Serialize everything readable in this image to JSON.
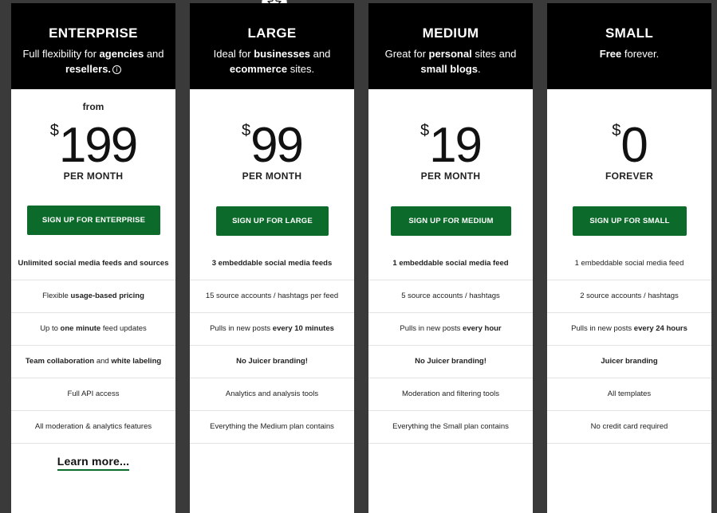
{
  "plans": [
    {
      "name": "ENTERPRISE",
      "desc_pre": "Full flexibility for ",
      "desc_b1": "agencies",
      "desc_mid": " and ",
      "desc_b2": "resellers.",
      "desc_post": "",
      "info_icon": "info-icon",
      "from": "from",
      "dollar": "$",
      "price": "199",
      "period": "PER MONTH",
      "cta": "SIGN UP FOR ENTERPRISE",
      "features": [
        "Unlimited social media feeds and sources",
        [
          "Flexible ",
          "usage-based pricing",
          ""
        ],
        [
          "Up to ",
          "one minute",
          " feed updates"
        ],
        [
          "",
          "Team collaboration",
          " and ",
          "white labeling"
        ],
        "Full API access",
        "All moderation & analytics features"
      ],
      "learn_more": "Learn more..."
    },
    {
      "name": "LARGE",
      "desc_pre": "Ideal for ",
      "desc_b1": "businesses",
      "desc_mid": " and ",
      "desc_b2": "ecommerce",
      "desc_post": " sites.",
      "dollar": "$",
      "price": "99",
      "period": "PER MONTH",
      "cta": "SIGN UP FOR LARGE",
      "features": [
        "3 embeddable social media feeds",
        "15 source accounts / hashtags per feed",
        [
          "Pulls in new posts ",
          "every 10 minutes",
          ""
        ],
        "No Juicer branding!",
        "Analytics and analysis tools",
        "Everything the Medium plan contains"
      ]
    },
    {
      "name": "MEDIUM",
      "desc_pre": "Great for ",
      "desc_b1": "personal",
      "desc_mid": " sites and ",
      "desc_b2": "small blogs",
      "desc_post": ".",
      "dollar": "$",
      "price": "19",
      "period": "PER MONTH",
      "cta": "SIGN UP FOR MEDIUM",
      "features": [
        "1 embeddable social media feed",
        "5 source accounts / hashtags",
        [
          "Pulls in new posts ",
          "every hour",
          ""
        ],
        "No Juicer branding!",
        "Moderation and filtering tools",
        "Everything the Small plan contains"
      ]
    },
    {
      "name": "SMALL",
      "desc_b1": "Free",
      "desc_post": " forever.",
      "dollar": "$",
      "price": "0",
      "period": "FOREVER",
      "cta": "SIGN UP FOR SMALL",
      "features": [
        "1 embeddable social media feed",
        "2 source accounts / hashtags",
        [
          "Pulls in new posts ",
          "every 24 hours",
          ""
        ],
        "Juicer branding",
        "All templates",
        "No credit card required"
      ]
    }
  ],
  "popular_badge_icon": "star-icon",
  "colors": {
    "header_bg": "#000000",
    "cta_green": "#0c6b2a",
    "page_bg": "#3a3a3a"
  }
}
